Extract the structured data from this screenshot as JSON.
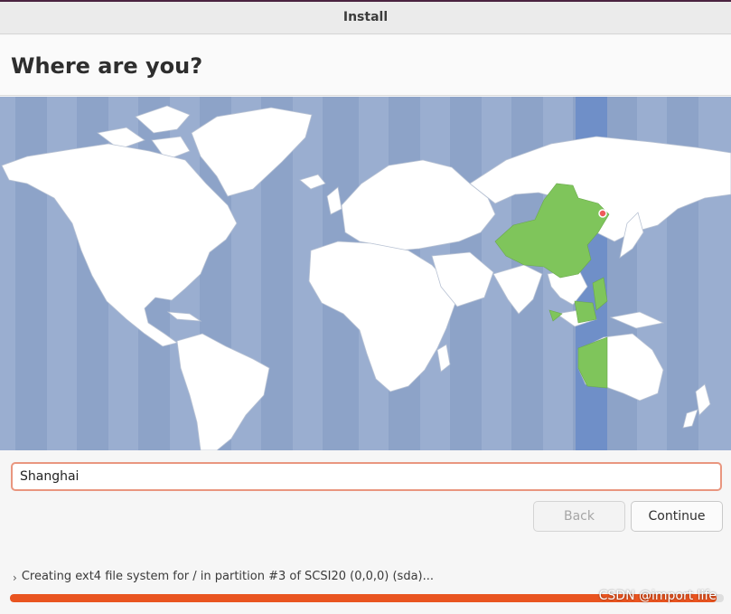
{
  "window": {
    "title": "Install"
  },
  "page": {
    "title": "Where are you?"
  },
  "map": {
    "selected_region_color": "#7fc55b",
    "selected_timezone_band_color": "#6f8fc8",
    "land_color": "#ffffff",
    "ocean_color": "#8da3c8"
  },
  "location": {
    "value": "Shanghai"
  },
  "buttons": {
    "back_label": "Back",
    "continue_label": "Continue"
  },
  "status": {
    "expander_icon": "chevron-right-icon",
    "text": "Creating ext4 file system for / in partition #3 of SCSI20 (0,0,0) (sda)...",
    "progress_percent": 99,
    "progress_color": "#e95420"
  },
  "watermark": {
    "text": "CSDN @import life"
  }
}
